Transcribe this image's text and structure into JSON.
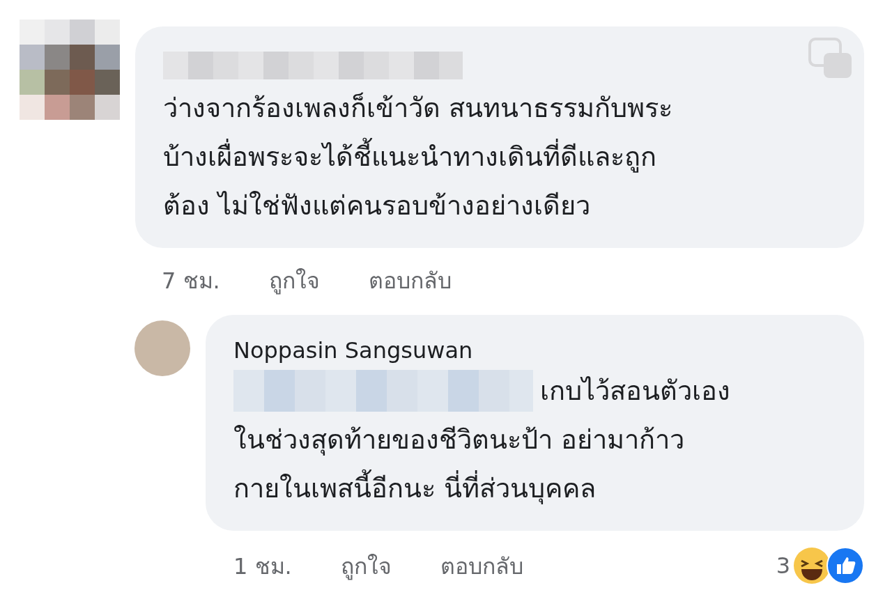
{
  "comments": [
    {
      "lines": [
        "ว่างจากร้องเพลงก็เข้าวัด สนทนาธรรมกับพระ",
        "บ้างเผื่อพระจะได้ชี้แนะนำทางเดินที่ดีและถูก",
        "ต้อง ไม่ใช่ฟังแต่คนรอบข้างอย่างเดียว"
      ],
      "redacted_lead": false,
      "actions": [
        "7 ชม.",
        "ถูกใจ",
        "ตอบกลับ"
      ]
    },
    {
      "author": "Noppasin Sangsuwan",
      "lines": [
        "เกบไว้สอนตัวเอง",
        "ในช่วงสุดท้ายของชีวิตนะป้า อย่ามาก้าว",
        "กายในเพสนี้อีกนะ นี่ที่ส่วนบุคคล"
      ],
      "redacted_lead": true,
      "actions": [
        "1 ชม.",
        "ถูกใจ",
        "ตอบกลับ"
      ],
      "reactions": {
        "count": "3"
      }
    }
  ]
}
